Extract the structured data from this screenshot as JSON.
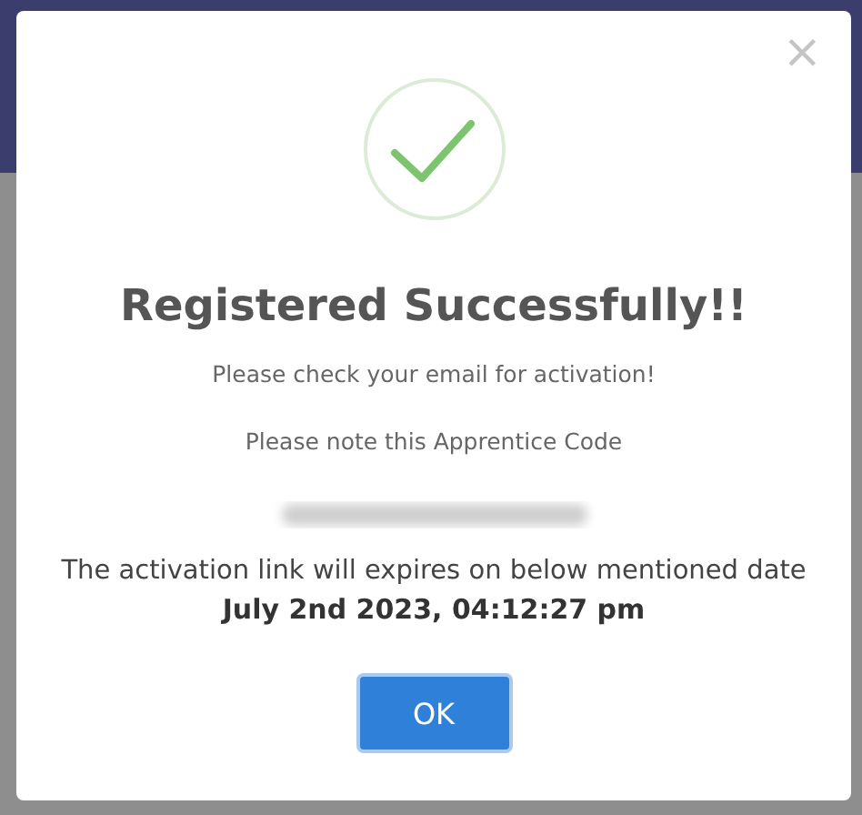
{
  "dialog": {
    "close": "×",
    "title": "Registered Successfully!!",
    "message": "Please check your email for activation!",
    "note": "Please note this Apprentice Code",
    "expiry_text": "The activation link will expires on below mentioned date",
    "expiry_date": "July 2nd 2023, 04:12:27 pm",
    "button": "OK"
  }
}
